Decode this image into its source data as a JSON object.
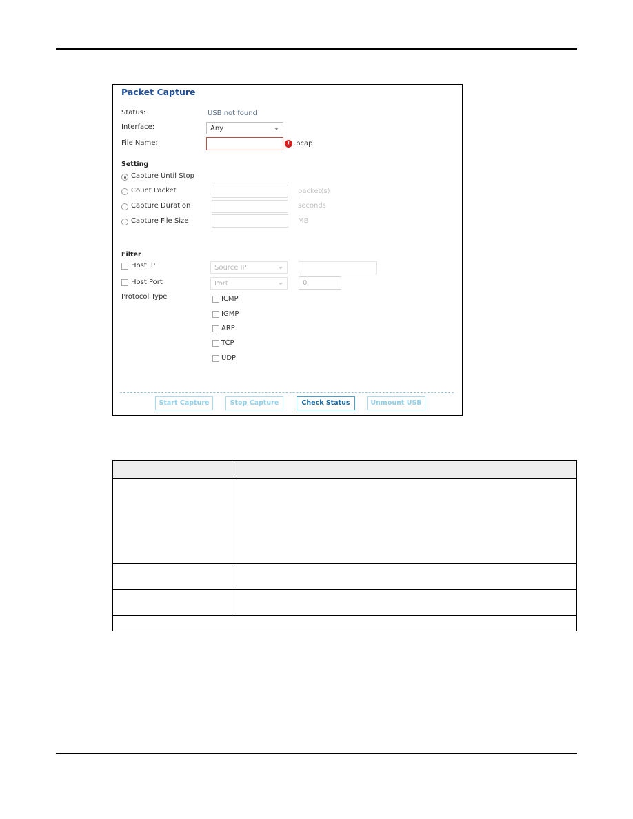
{
  "page": {
    "header_rule": true,
    "footer_rule": true
  },
  "panel": {
    "title": "Packet Capture",
    "status": {
      "label": "Status:",
      "value": "USB not found"
    },
    "interface": {
      "label": "Interface:",
      "value": "Any"
    },
    "file_name": {
      "label": "File Name:",
      "value": "",
      "suffix": ".pcap",
      "error_icon": "!"
    },
    "setting": {
      "heading": "Setting",
      "options": [
        {
          "label": "Capture Until Stop",
          "selected": true
        },
        {
          "label": "Count Packet",
          "selected": false,
          "value": "",
          "unit": "packet(s)"
        },
        {
          "label": "Capture Duration",
          "selected": false,
          "value": "",
          "unit": "seconds"
        },
        {
          "label": "Capture File Size",
          "selected": false,
          "value": "",
          "unit": "MB"
        }
      ]
    },
    "filter": {
      "heading": "Filter",
      "host_ip": {
        "label": "Host IP",
        "checked": false,
        "select": "Source IP",
        "value": ""
      },
      "host_port": {
        "label": "Host Port",
        "checked": false,
        "select": "Port",
        "value": "0"
      },
      "protocol_type": {
        "label": "Protocol Type",
        "protocols": [
          {
            "label": "ICMP",
            "checked": false
          },
          {
            "label": "IGMP",
            "checked": false
          },
          {
            "label": "ARP",
            "checked": false
          },
          {
            "label": "TCP",
            "checked": false
          },
          {
            "label": "UDP",
            "checked": false
          }
        ]
      }
    },
    "buttons": {
      "start": "Start Capture",
      "stop": "Stop Capture",
      "check": "Check Status",
      "unmount": "Unmount USB"
    }
  },
  "table": {
    "headers": [
      "",
      ""
    ],
    "rows": [
      [
        "",
        ""
      ],
      [
        "",
        ""
      ],
      [
        "",
        ""
      ]
    ],
    "footer": ""
  }
}
